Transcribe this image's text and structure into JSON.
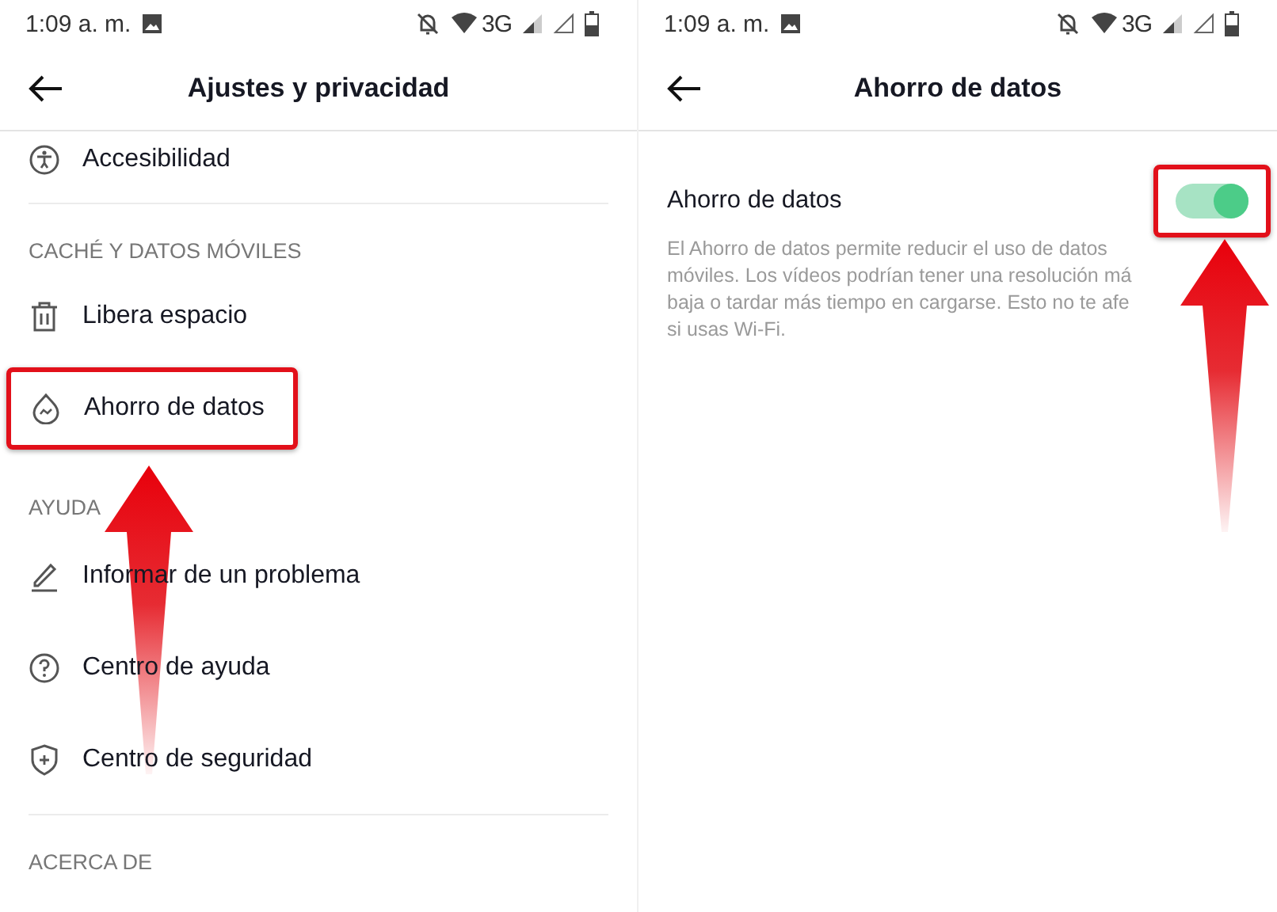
{
  "screens": [
    {
      "status_bar": {
        "time": "1:09 a. m.",
        "network": "3G"
      },
      "title": "Ajustes y privacidad",
      "sections": [
        {
          "items": [
            {
              "label": "Accesibilidad",
              "highlighted": false
            }
          ]
        },
        {
          "divider_above": true,
          "header": "CACHÉ Y DATOS MÓVILES",
          "items": [
            {
              "label": "Libera espacio",
              "highlighted": false
            },
            {
              "label": "Ahorro de datos",
              "highlighted": true
            }
          ]
        },
        {
          "divider_above": false,
          "header": "AYUDA",
          "items": [
            {
              "label": "Informar de un problema",
              "highlighted": false
            },
            {
              "label": "Centro de ayuda",
              "highlighted": false
            },
            {
              "label": "Centro de seguridad",
              "highlighted": false
            }
          ]
        },
        {
          "divider_above": true,
          "header": "ACERCA DE"
        }
      ]
    },
    {
      "status_bar": {
        "time": "1:09 a. m.",
        "network": "3G"
      },
      "title": "Ahorro de datos",
      "setting": {
        "label": "Ahorro de datos",
        "on": true,
        "highlighted": true,
        "description_lines": [
          "El Ahorro de datos permite reducir el uso de datos",
          "móviles. Los vídeos podrían tener una resolución má",
          "baja o tardar más tiempo en cargarse. Esto no te afe",
          "si usas Wi-Fi."
        ]
      }
    }
  ]
}
